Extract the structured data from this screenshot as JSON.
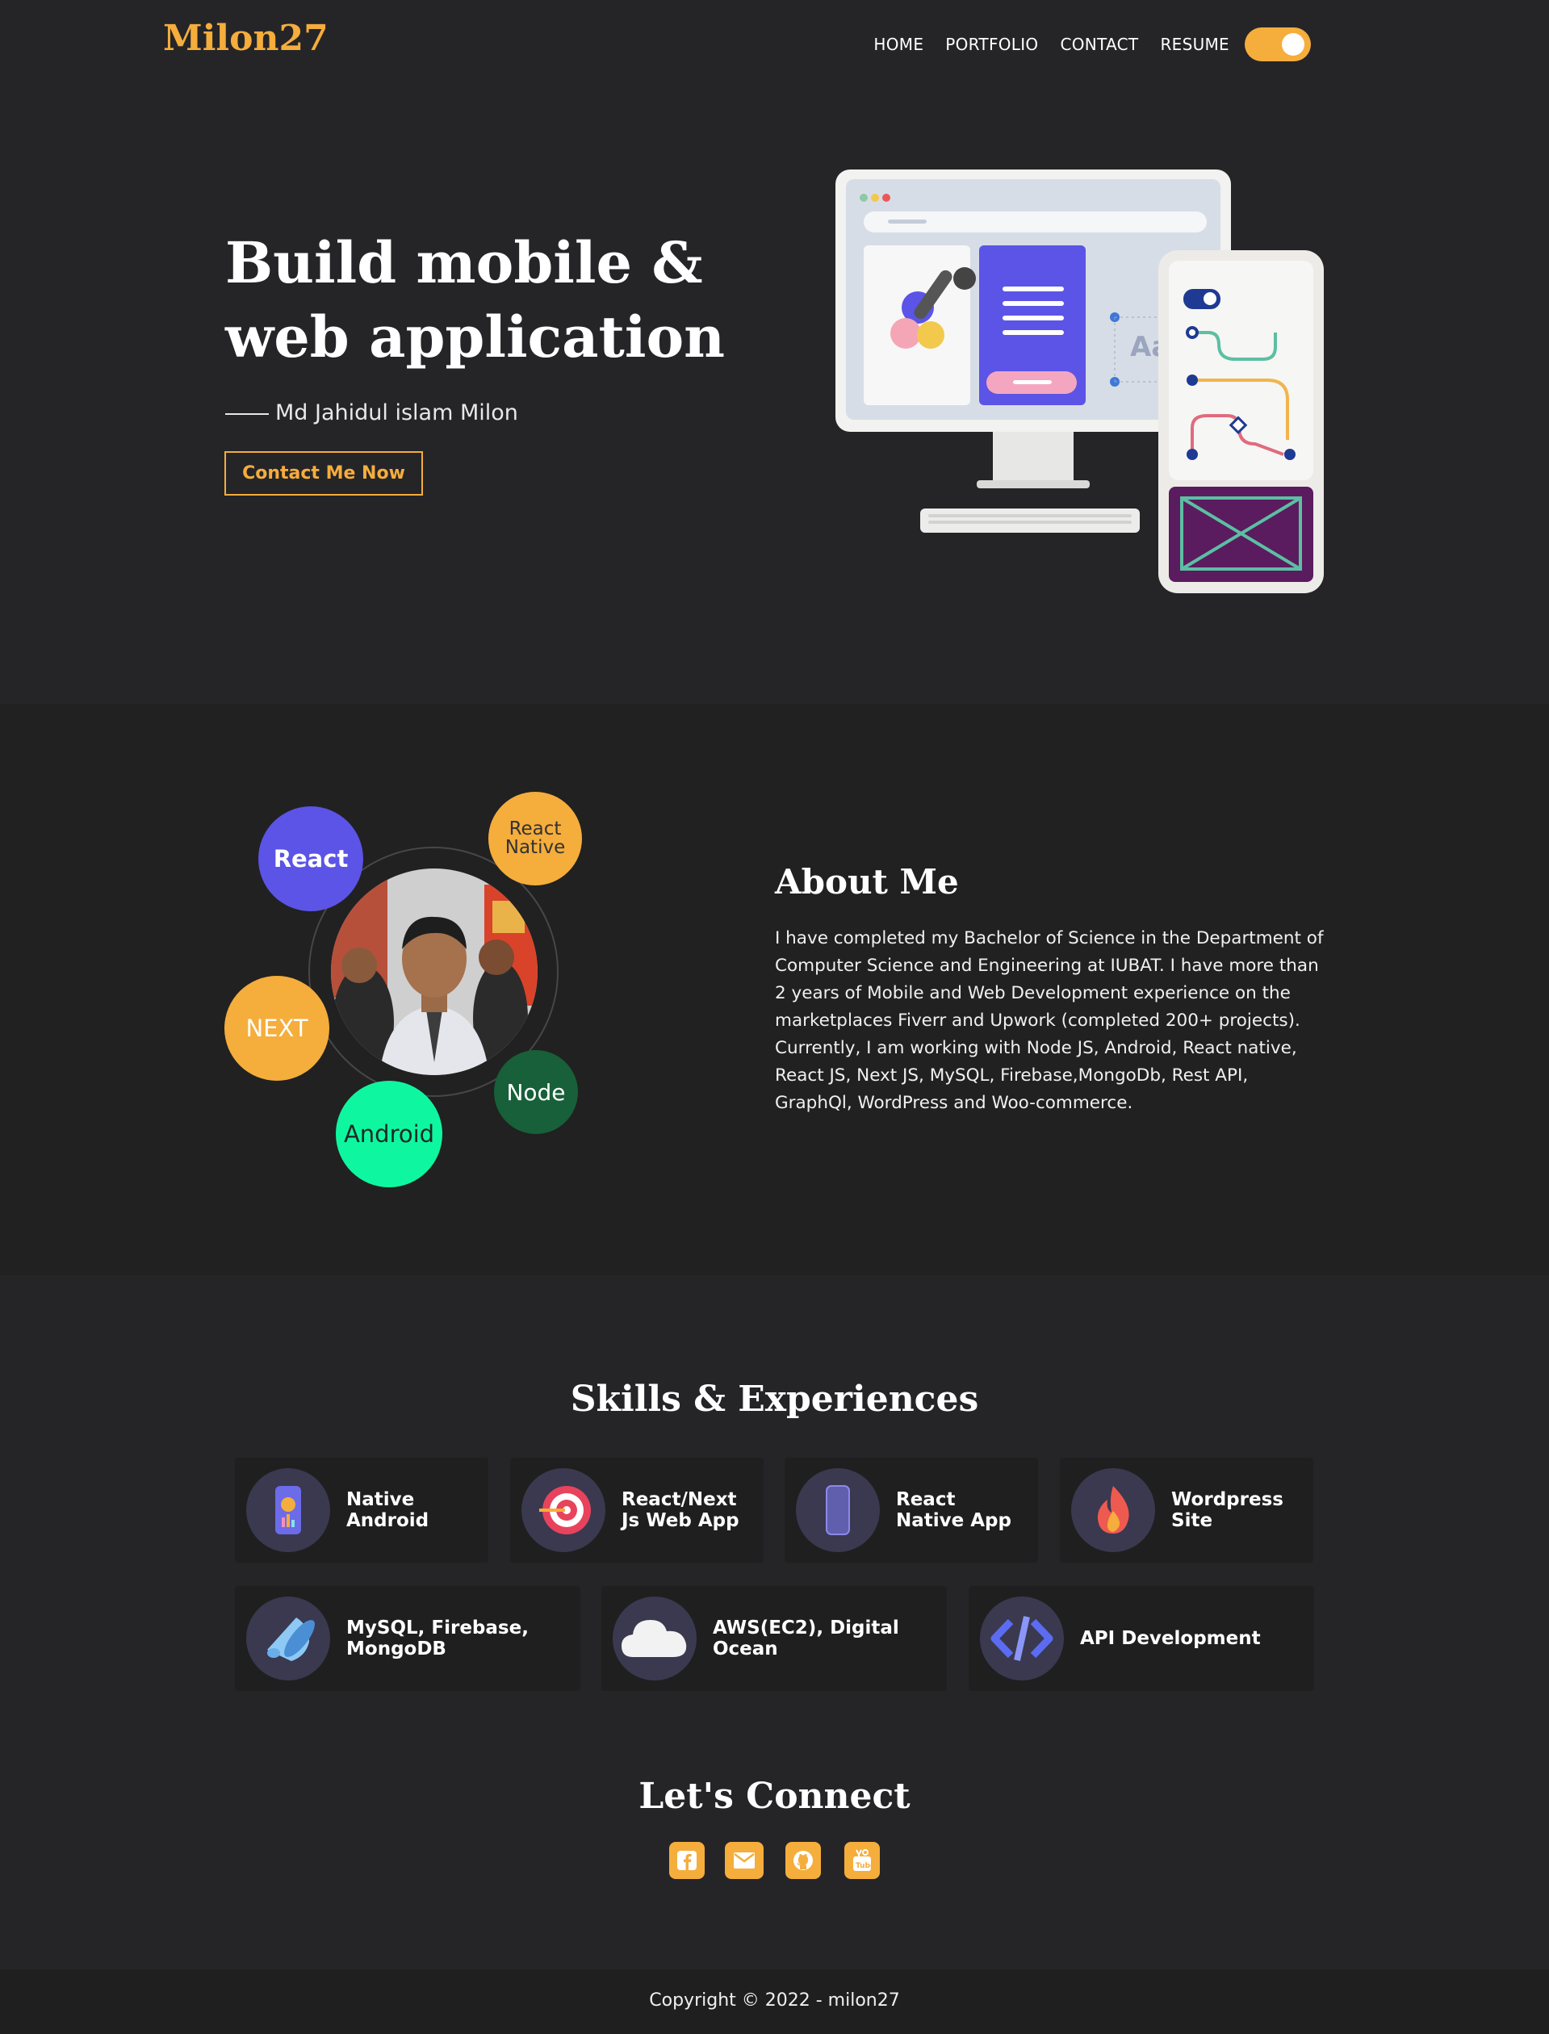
{
  "header": {
    "logo": "Milon27",
    "nav": [
      "HOME",
      "PORTFOLIO",
      "CONTACT",
      "RESUME"
    ],
    "theme_toggle_on": true
  },
  "hero": {
    "title": "Build mobile & web application",
    "subtitle": "Md Jahidul islam Milon",
    "cta": "Contact Me Now"
  },
  "about": {
    "bubbles": [
      "React",
      "React Native",
      "NEXT",
      "Node",
      "Android"
    ],
    "title": "About Me",
    "text": "I have completed my Bachelor of Science in the Department of Computer Science and Engineering at IUBAT. I have more than 2 years of Mobile and Web Development experience on the marketplaces Fiverr and Upwork (completed 200+ projects). Currently, I am working with Node JS, Android, React native, React JS, Next JS, MySQL, Firebase,MongoDb, Rest API, GraphQl, WordPress and Woo-commerce."
  },
  "skills": {
    "title": "Skills & Experiences",
    "items": [
      "Native Android",
      "React/Next Js Web App",
      "React Native App",
      "Wordpress Site",
      "MySQL, Firebase, MongoDB",
      "AWS(EC2), Digital Ocean",
      "API Development"
    ]
  },
  "connect": {
    "title": "Let's Connect",
    "icons": [
      "facebook-icon",
      "email-icon",
      "github-icon",
      "youtube-icon"
    ]
  },
  "footer": {
    "copyright": "Copyright © 2022 - milon27"
  },
  "colors": {
    "accent": "#f5ad3c",
    "background": "#252528",
    "section_alt": "#212121",
    "card": "#1f1f1f",
    "react_bubble": "#5b54e6",
    "node_bubble": "#176039",
    "android_bubble": "#0ef7a0"
  }
}
